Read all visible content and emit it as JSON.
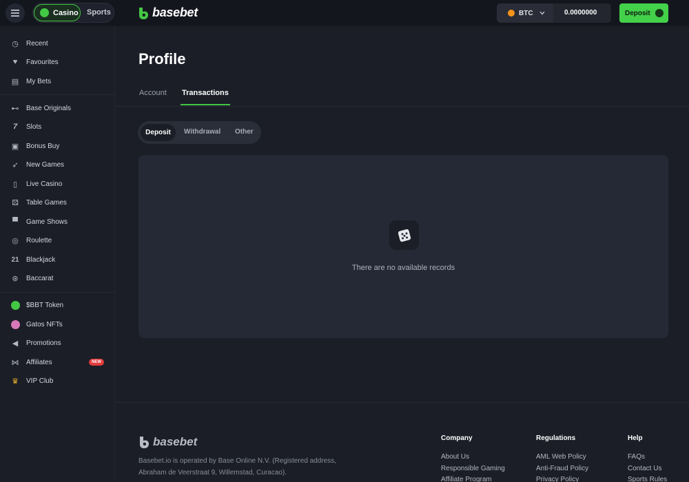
{
  "header": {
    "menu_icon": "hamburger-icon",
    "modes": [
      {
        "label": "Casino",
        "active": true
      },
      {
        "label": "Sports",
        "active": false
      }
    ],
    "logo_text": "basebet",
    "currency": "BTC",
    "balance": "0.0000000",
    "deposit_label": "Deposit",
    "accent_color": "#43c844"
  },
  "sidebar": {
    "groups": [
      [
        {
          "label": "Recent",
          "icon": "clock-icon"
        },
        {
          "label": "Favourites",
          "icon": "heart-icon"
        },
        {
          "label": "My Bets",
          "icon": "receipt-icon"
        }
      ],
      [
        {
          "label": "Base Originals",
          "icon": "gamepad-icon"
        },
        {
          "label": "Slots",
          "icon": "seven-icon"
        },
        {
          "label": "Bonus Buy",
          "icon": "gift-icon"
        },
        {
          "label": "New Games",
          "icon": "rocket-icon"
        },
        {
          "label": "Live Casino",
          "icon": "card-icon"
        },
        {
          "label": "Table Games",
          "icon": "dice-icon"
        },
        {
          "label": "Game Shows",
          "icon": "top-hat-icon"
        },
        {
          "label": "Roulette",
          "icon": "roulette-icon"
        },
        {
          "label": "Blackjack",
          "icon": "twenty-one-icon"
        },
        {
          "label": "Baccarat",
          "icon": "chip-icon"
        }
      ],
      [
        {
          "label": "$BBT Token",
          "icon": "token-icon"
        },
        {
          "label": "Gatos NFTs",
          "icon": "cat-icon"
        },
        {
          "label": "Promotions",
          "icon": "megaphone-icon"
        },
        {
          "label": "Affiliates",
          "icon": "handshake-icon",
          "badge": "NEW"
        },
        {
          "label": "VIP Club",
          "icon": "crown-icon"
        }
      ]
    ]
  },
  "main": {
    "title": "Profile",
    "tabs": [
      {
        "label": "Account",
        "active": false
      },
      {
        "label": "Transactions",
        "active": true
      }
    ],
    "filters": [
      {
        "label": "Deposit",
        "active": true
      },
      {
        "label": "Withdrawal",
        "active": false
      },
      {
        "label": "Other",
        "active": false
      }
    ],
    "empty_icon": "dice-icon",
    "empty_text": "There are no available records"
  },
  "footer": {
    "logo_text": "basebet",
    "description_line1": "Basebet.io is operated by Base Online N.V. (Registered address,",
    "description_line2": "Abraham de Veerstraat 9, Willemstad, Curacao).",
    "columns": [
      {
        "title": "Company",
        "links": [
          "About Us",
          "Responsible Gaming",
          "Affiliate Program"
        ]
      },
      {
        "title": "Regulations",
        "links": [
          "AML Web Policy",
          "Anti-Fraud Policy",
          "Privacy Policy"
        ]
      },
      {
        "title": "Help",
        "links": [
          "FAQs",
          "Contact Us",
          "Sports Rules"
        ]
      }
    ]
  }
}
